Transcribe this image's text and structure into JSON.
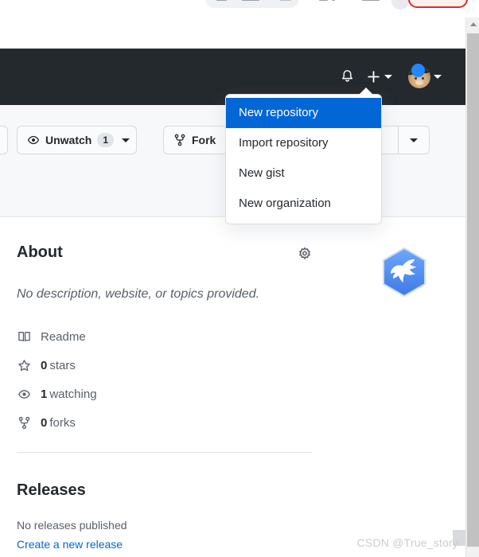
{
  "browser": {
    "toolbar_visible_sliver": true,
    "red_outline_pill": "",
    "accent_red": "#d93025"
  },
  "header": {
    "background": "#24292e",
    "notifications_icon": "bell-icon",
    "create_new_icon": "plus-icon",
    "create_new_caret": "chevron-down-icon",
    "avatar_alt": "user avatar",
    "avatar_badge": "blue-dot",
    "avatar_caret": "chevron-down-icon"
  },
  "create_menu": {
    "items": [
      {
        "label": "New repository",
        "selected": true
      },
      {
        "label": "Import repository",
        "selected": false
      },
      {
        "label": "New gist",
        "selected": false
      },
      {
        "label": "New organization",
        "selected": false
      }
    ],
    "highlight_color": "#0366d6"
  },
  "repo_actions": {
    "watch": {
      "icon": "eye-icon",
      "label": "Unwatch",
      "count": "1",
      "caret": "chevron-down-icon"
    },
    "fork": {
      "icon": "repo-forked-icon",
      "label": "Fork"
    },
    "star_group": {
      "caret": "chevron-down-icon"
    }
  },
  "about": {
    "title": "About",
    "settings_icon": "gear-icon",
    "description": "No description, website, or topics provided.",
    "stats": [
      {
        "icon": "book-icon",
        "value": "",
        "label": "Readme"
      },
      {
        "icon": "star-icon",
        "value": "0",
        "label": "stars"
      },
      {
        "icon": "eye-icon",
        "value": "1",
        "label": "watching"
      },
      {
        "icon": "repo-forked-icon",
        "value": "0",
        "label": "forks"
      }
    ]
  },
  "releases": {
    "title": "Releases",
    "empty_text": "No releases published",
    "create_link": "Create a new release",
    "link_color": "#0366d6"
  },
  "floating_badge": {
    "icon": "bird-hexagon-icon",
    "color": "#5b9bf8"
  },
  "scrollbar": {
    "up_arrow": "chevron-up-icon",
    "thumb_color": "#c1c1c1"
  },
  "watermark": {
    "text": "CSDN @True_story"
  }
}
